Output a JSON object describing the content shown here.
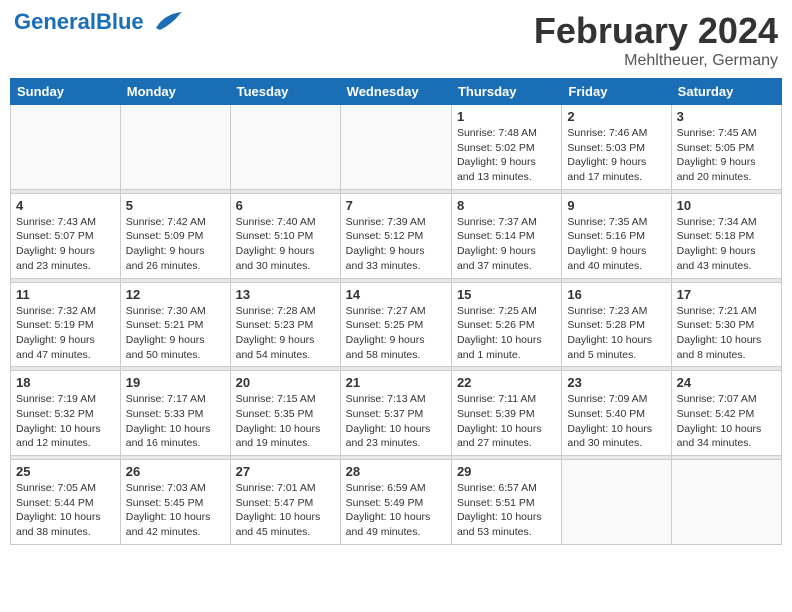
{
  "header": {
    "logo_general": "General",
    "logo_blue": "Blue",
    "month_title": "February 2024",
    "location": "Mehltheuer, Germany"
  },
  "days_of_week": [
    "Sunday",
    "Monday",
    "Tuesday",
    "Wednesday",
    "Thursday",
    "Friday",
    "Saturday"
  ],
  "weeks": [
    [
      {
        "day": "",
        "info": ""
      },
      {
        "day": "",
        "info": ""
      },
      {
        "day": "",
        "info": ""
      },
      {
        "day": "",
        "info": ""
      },
      {
        "day": "1",
        "info": "Sunrise: 7:48 AM\nSunset: 5:02 PM\nDaylight: 9 hours\nand 13 minutes."
      },
      {
        "day": "2",
        "info": "Sunrise: 7:46 AM\nSunset: 5:03 PM\nDaylight: 9 hours\nand 17 minutes."
      },
      {
        "day": "3",
        "info": "Sunrise: 7:45 AM\nSunset: 5:05 PM\nDaylight: 9 hours\nand 20 minutes."
      }
    ],
    [
      {
        "day": "4",
        "info": "Sunrise: 7:43 AM\nSunset: 5:07 PM\nDaylight: 9 hours\nand 23 minutes."
      },
      {
        "day": "5",
        "info": "Sunrise: 7:42 AM\nSunset: 5:09 PM\nDaylight: 9 hours\nand 26 minutes."
      },
      {
        "day": "6",
        "info": "Sunrise: 7:40 AM\nSunset: 5:10 PM\nDaylight: 9 hours\nand 30 minutes."
      },
      {
        "day": "7",
        "info": "Sunrise: 7:39 AM\nSunset: 5:12 PM\nDaylight: 9 hours\nand 33 minutes."
      },
      {
        "day": "8",
        "info": "Sunrise: 7:37 AM\nSunset: 5:14 PM\nDaylight: 9 hours\nand 37 minutes."
      },
      {
        "day": "9",
        "info": "Sunrise: 7:35 AM\nSunset: 5:16 PM\nDaylight: 9 hours\nand 40 minutes."
      },
      {
        "day": "10",
        "info": "Sunrise: 7:34 AM\nSunset: 5:18 PM\nDaylight: 9 hours\nand 43 minutes."
      }
    ],
    [
      {
        "day": "11",
        "info": "Sunrise: 7:32 AM\nSunset: 5:19 PM\nDaylight: 9 hours\nand 47 minutes."
      },
      {
        "day": "12",
        "info": "Sunrise: 7:30 AM\nSunset: 5:21 PM\nDaylight: 9 hours\nand 50 minutes."
      },
      {
        "day": "13",
        "info": "Sunrise: 7:28 AM\nSunset: 5:23 PM\nDaylight: 9 hours\nand 54 minutes."
      },
      {
        "day": "14",
        "info": "Sunrise: 7:27 AM\nSunset: 5:25 PM\nDaylight: 9 hours\nand 58 minutes."
      },
      {
        "day": "15",
        "info": "Sunrise: 7:25 AM\nSunset: 5:26 PM\nDaylight: 10 hours\nand 1 minute."
      },
      {
        "day": "16",
        "info": "Sunrise: 7:23 AM\nSunset: 5:28 PM\nDaylight: 10 hours\nand 5 minutes."
      },
      {
        "day": "17",
        "info": "Sunrise: 7:21 AM\nSunset: 5:30 PM\nDaylight: 10 hours\nand 8 minutes."
      }
    ],
    [
      {
        "day": "18",
        "info": "Sunrise: 7:19 AM\nSunset: 5:32 PM\nDaylight: 10 hours\nand 12 minutes."
      },
      {
        "day": "19",
        "info": "Sunrise: 7:17 AM\nSunset: 5:33 PM\nDaylight: 10 hours\nand 16 minutes."
      },
      {
        "day": "20",
        "info": "Sunrise: 7:15 AM\nSunset: 5:35 PM\nDaylight: 10 hours\nand 19 minutes."
      },
      {
        "day": "21",
        "info": "Sunrise: 7:13 AM\nSunset: 5:37 PM\nDaylight: 10 hours\nand 23 minutes."
      },
      {
        "day": "22",
        "info": "Sunrise: 7:11 AM\nSunset: 5:39 PM\nDaylight: 10 hours\nand 27 minutes."
      },
      {
        "day": "23",
        "info": "Sunrise: 7:09 AM\nSunset: 5:40 PM\nDaylight: 10 hours\nand 30 minutes."
      },
      {
        "day": "24",
        "info": "Sunrise: 7:07 AM\nSunset: 5:42 PM\nDaylight: 10 hours\nand 34 minutes."
      }
    ],
    [
      {
        "day": "25",
        "info": "Sunrise: 7:05 AM\nSunset: 5:44 PM\nDaylight: 10 hours\nand 38 minutes."
      },
      {
        "day": "26",
        "info": "Sunrise: 7:03 AM\nSunset: 5:45 PM\nDaylight: 10 hours\nand 42 minutes."
      },
      {
        "day": "27",
        "info": "Sunrise: 7:01 AM\nSunset: 5:47 PM\nDaylight: 10 hours\nand 45 minutes."
      },
      {
        "day": "28",
        "info": "Sunrise: 6:59 AM\nSunset: 5:49 PM\nDaylight: 10 hours\nand 49 minutes."
      },
      {
        "day": "29",
        "info": "Sunrise: 6:57 AM\nSunset: 5:51 PM\nDaylight: 10 hours\nand 53 minutes."
      },
      {
        "day": "",
        "info": ""
      },
      {
        "day": "",
        "info": ""
      }
    ]
  ]
}
